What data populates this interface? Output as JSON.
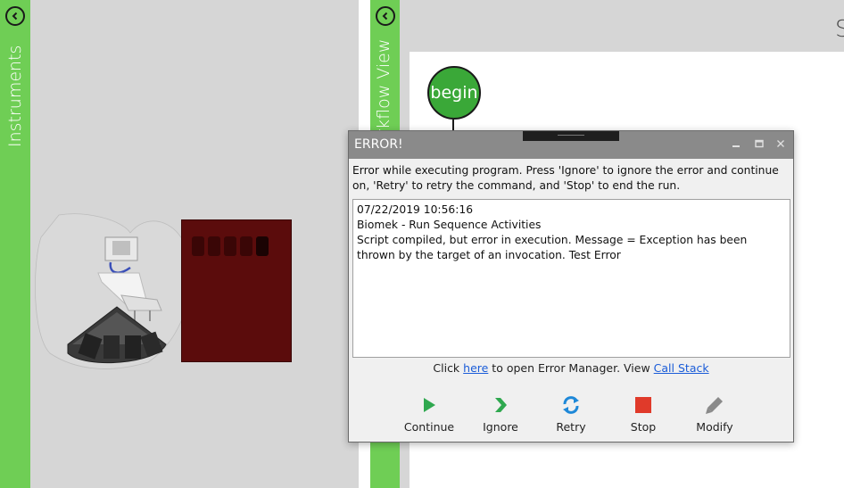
{
  "instruments_panel": {
    "label": "Instruments"
  },
  "workflow_panel": {
    "label": "Workflow View",
    "title_fragment": "S",
    "begin_node": "begin"
  },
  "error_dialog": {
    "title": "ERROR!",
    "message": "Error while executing program.  Press 'Ignore' to ignore the error and continue on, 'Retry' to retry the command, and 'Stop' to end the run.",
    "log": [
      "07/22/2019 10:56:16",
      "Biomek - Run Sequence Activities",
      "Script compiled, but error in execution. Message = Exception has been thrown by the target of an invocation. Test Error"
    ],
    "links_prefix": "Click ",
    "here_link": "here",
    "links_middle": " to open Error Manager.  View ",
    "call_stack_link": "Call Stack",
    "actions": [
      {
        "label": "Continue",
        "icon": "play-icon",
        "color": "#2fa84f"
      },
      {
        "label": "Ignore",
        "icon": "chevron-right-icon",
        "color": "#2fa84f"
      },
      {
        "label": "Retry",
        "icon": "refresh-icon",
        "color": "#1e88d8"
      },
      {
        "label": "Stop",
        "icon": "stop-icon",
        "color": "#e03a2a"
      },
      {
        "label": "Modify",
        "icon": "pencil-icon",
        "color": "#8a8a8a"
      }
    ]
  },
  "colors": {
    "accent_green": "#6fce55",
    "panel_gray": "#d6d6d6",
    "node_green": "#3aa838"
  }
}
